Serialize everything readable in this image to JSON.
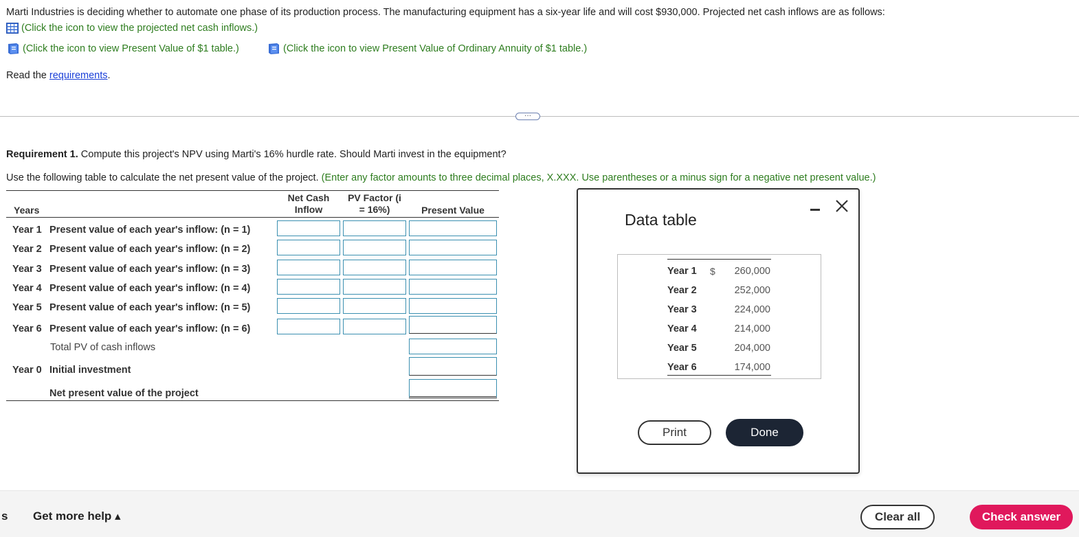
{
  "intro": {
    "text": "Marti Industries is deciding whether to automate one phase of its production process. The manufacturing equipment has a six-year life and will cost $930,000. Projected net cash inflows are as follows:",
    "cash_inflows_link": "(Click the icon to view the projected net cash inflows.)",
    "pv1_link": "(Click the icon to view Present Value of $1 table.)",
    "pvoa_link": "(Click the icon to view Present Value of Ordinary Annuity of $1 table.)",
    "read_prefix": "Read the",
    "requirements_link": "requirements",
    "read_suffix": "."
  },
  "expander_label": "···",
  "requirement": {
    "label": "Requirement 1.",
    "text": "Compute this project's NPV using Marti's 16% hurdle rate. Should Marti invest in the equipment?",
    "instruction": "Use the following table to calculate the net present value of the project.",
    "hint": "(Enter any factor amounts to three decimal places, X.XXX. Use parentheses or a minus sign for a negative net present value.)"
  },
  "table": {
    "col_years": "Years",
    "col_net_cash_1": "Net Cash",
    "col_net_cash_2": "Inflow",
    "col_pv_factor_1": "PV Factor (i",
    "col_pv_factor_2": "= 16%)",
    "col_present_value": "Present Value",
    "rows": [
      {
        "year": "Year 1",
        "desc": "Present value of each year's inflow: (n = 1)"
      },
      {
        "year": "Year 2",
        "desc": "Present value of each year's inflow: (n = 2)"
      },
      {
        "year": "Year 3",
        "desc": "Present value of each year's inflow: (n = 3)"
      },
      {
        "year": "Year 4",
        "desc": "Present value of each year's inflow: (n = 4)"
      },
      {
        "year": "Year 5",
        "desc": "Present value of each year's inflow: (n = 5)"
      },
      {
        "year": "Year 6",
        "desc": "Present value of each year's inflow: (n = 6)"
      }
    ],
    "total_label": "Total PV of cash inflows",
    "year0": "Year 0",
    "initial_investment": "Initial investment",
    "npv_label": "Net present value of the project"
  },
  "modal": {
    "title": "Data table",
    "currency": "$",
    "rows": [
      {
        "year": "Year 1",
        "value": "260,000"
      },
      {
        "year": "Year 2",
        "value": "252,000"
      },
      {
        "year": "Year 3",
        "value": "224,000"
      },
      {
        "year": "Year 4",
        "value": "214,000"
      },
      {
        "year": "Year 5",
        "value": "204,000"
      },
      {
        "year": "Year 6",
        "value": "174,000"
      }
    ],
    "print_label": "Print",
    "done_label": "Done"
  },
  "footer": {
    "left_fragment": "s",
    "help_label": "Get more help ▴",
    "clear_label": "Clear all",
    "check_label": "Check answer"
  },
  "colors": {
    "green_text": "#2e7d1f",
    "link_blue": "#1a3fd8",
    "input_border": "#3a8fb0",
    "done_bg": "#1c2534",
    "check_bg": "#e0185c"
  }
}
